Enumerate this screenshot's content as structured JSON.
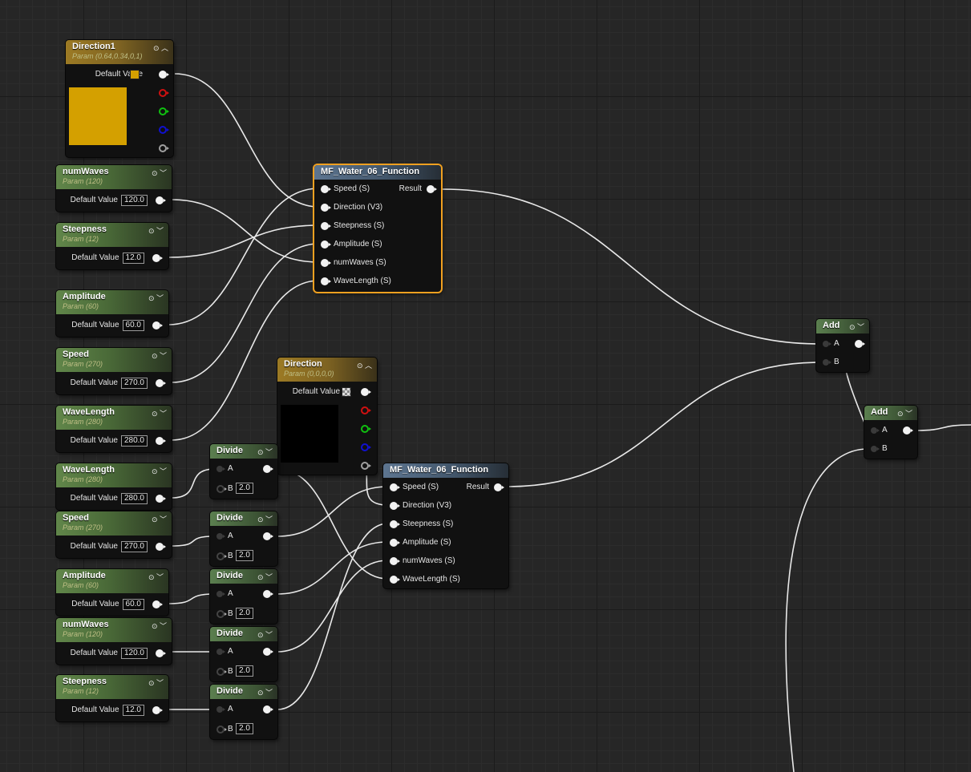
{
  "colors": {
    "accent_selected": "#f0a020",
    "vector_param": "#d4a000",
    "direction_preview": "#000000",
    "channel_r": "#d01010",
    "channel_g": "#10c010",
    "channel_b": "#1010d0",
    "channel_a": "#a0a0a0"
  },
  "vector_params": [
    {
      "title": "Direction1",
      "subtitle": "Param (0.64,0.34,0,1)",
      "default_label": "Default Value",
      "swatch": "#d4a000"
    },
    {
      "title": "Direction",
      "subtitle": "Param (0,0,0,0)",
      "default_label": "Default Value",
      "swatch": "checker"
    }
  ],
  "scalar_params": [
    {
      "title": "numWaves",
      "subtitle": "Param (120)",
      "default_label": "Default Value",
      "value": "120.0"
    },
    {
      "title": "Steepness",
      "subtitle": "Param (12)",
      "default_label": "Default Value",
      "value": "12.0"
    },
    {
      "title": "Amplitude",
      "subtitle": "Param (60)",
      "default_label": "Default Value",
      "value": "60.0"
    },
    {
      "title": "Speed",
      "subtitle": "Param (270)",
      "default_label": "Default Value",
      "value": "270.0"
    },
    {
      "title": "WaveLength",
      "subtitle": "Param (280)",
      "default_label": "Default Value",
      "value": "280.0"
    },
    {
      "title": "WaveLength",
      "subtitle": "Param (280)",
      "default_label": "Default Value",
      "value": "280.0"
    },
    {
      "title": "Speed",
      "subtitle": "Param (270)",
      "default_label": "Default Value",
      "value": "270.0"
    },
    {
      "title": "Amplitude",
      "subtitle": "Param (60)",
      "default_label": "Default Value",
      "value": "60.0"
    },
    {
      "title": "numWaves",
      "subtitle": "Param (120)",
      "default_label": "Default Value",
      "value": "120.0"
    },
    {
      "title": "Steepness",
      "subtitle": "Param (12)",
      "default_label": "Default Value",
      "value": "12.0"
    }
  ],
  "functions": [
    {
      "title": "MF_Water_06_Function",
      "inputs": [
        "Speed (S)",
        "Direction (V3)",
        "Steepness (S)",
        "Amplitude (S)",
        "numWaves (S)",
        "WaveLength (S)"
      ],
      "output": "Result"
    },
    {
      "title": "MF_Water_06_Function",
      "inputs": [
        "Speed (S)",
        "Direction (V3)",
        "Steepness (S)",
        "Amplitude (S)",
        "numWaves (S)",
        "WaveLength (S)"
      ],
      "output": "Result"
    }
  ],
  "divides": [
    {
      "title": "Divide",
      "a": "A",
      "b": "B",
      "b_value": "2.0"
    },
    {
      "title": "Divide",
      "a": "A",
      "b": "B",
      "b_value": "2.0"
    },
    {
      "title": "Divide",
      "a": "A",
      "b": "B",
      "b_value": "2.0"
    },
    {
      "title": "Divide",
      "a": "A",
      "b": "B",
      "b_value": "2.0"
    },
    {
      "title": "Divide",
      "a": "A",
      "b": "B",
      "b_value": "2.0"
    }
  ],
  "adds": [
    {
      "title": "Add",
      "a": "A",
      "b": "B"
    },
    {
      "title": "Add",
      "a": "A",
      "b": "B"
    }
  ],
  "icons": {
    "preview_toggle": "circle-arrow-icon",
    "collapse": "chevron-icon",
    "expand_up": "chevron-up-icon"
  }
}
